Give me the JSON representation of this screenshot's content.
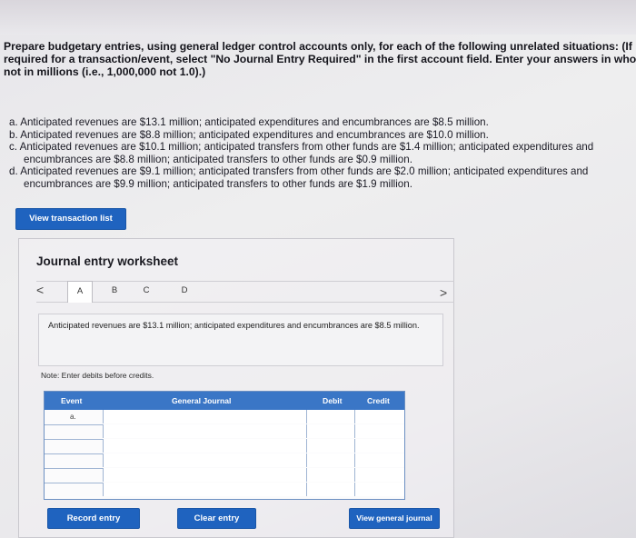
{
  "prompt": {
    "line1": "Prepare budgetary entries, using general ledger control accounts only, for each of the following unrelated situations: (If no entr",
    "line2": "required for a transaction/event, select \"No Journal Entry Required\" in the first account field. Enter your answers in whole d",
    "line3": "not in millions (i.e., 1,000,000 not 1.0).)"
  },
  "situations": [
    {
      "line1": "a. Anticipated revenues are $13.1 million; anticipated expenditures and encumbrances are $8.5 million.",
      "line2": ""
    },
    {
      "line1": "b. Anticipated revenues are $8.8 million; anticipated expenditures and encumbrances are $10.0 million.",
      "line2": ""
    },
    {
      "line1": "c. Anticipated revenues are $10.1 million; anticipated transfers from other funds are $1.4 million; anticipated expenditures and",
      "line2": "encumbrances are $8.8 million; anticipated transfers to other funds are $0.9 million."
    },
    {
      "line1": "d. Anticipated revenues are $9.1 million; anticipated transfers from other funds are $2.0 million; anticipated expenditures and",
      "line2": "encumbrances are $9.9 million; anticipated transfers to other funds are $1.9 million."
    }
  ],
  "view_transaction_list": "View transaction list",
  "worksheet": {
    "title": "Journal entry worksheet",
    "prev": "<",
    "next": ">",
    "tabs": [
      "A",
      "B",
      "C",
      "D"
    ],
    "description": "Anticipated revenues are $13.1 million; anticipated expenditures and encumbrances are $8.5 million.",
    "note": "Note: Enter debits before credits.",
    "columns": {
      "event": "Event",
      "general_journal": "General Journal",
      "debit": "Debit",
      "credit": "Credit"
    },
    "first_event": "a.",
    "buttons": {
      "record": "Record entry",
      "clear": "Clear entry",
      "view_journal": "View general journal"
    }
  },
  "colors": {
    "button_blue": "#1f63bf",
    "header_blue": "#3a76c6"
  }
}
